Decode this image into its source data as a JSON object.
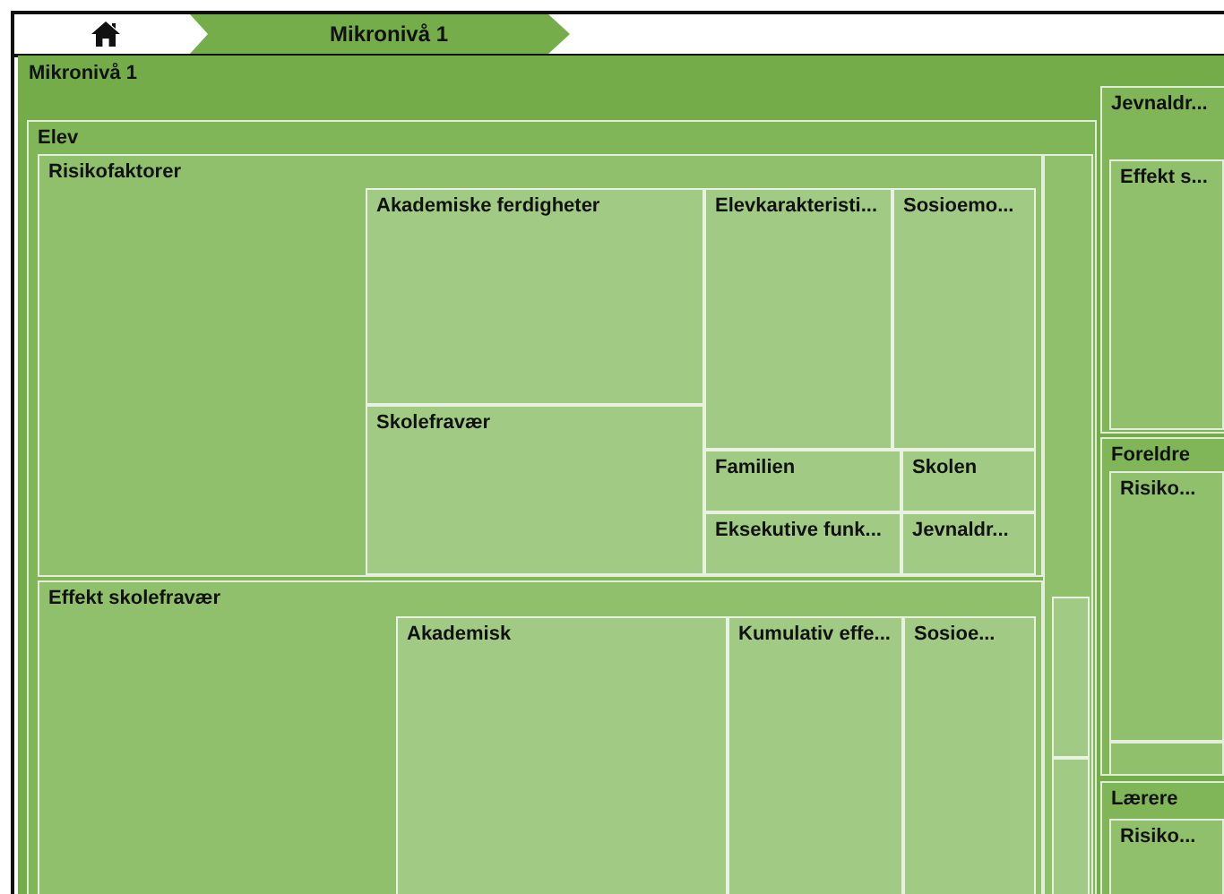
{
  "breadcrumb": [
    {
      "kind": "home"
    },
    {
      "kind": "crumb",
      "label": "Mikronivå 1"
    }
  ],
  "treemap": {
    "kind": "tile",
    "label": "Mikronivå 1",
    "children": [
      {
        "kind": "tile",
        "label": "Elev",
        "children": [
          {
            "kind": "tile",
            "label": "Risikofaktorer",
            "children": [
              {
                "kind": "tile",
                "label": "Akademiske ferdigheter"
              },
              {
                "kind": "tile",
                "label": "Skolefravær"
              },
              {
                "kind": "tile",
                "label": "Elevkarakteristi..."
              },
              {
                "kind": "tile",
                "label": "Sosioemo..."
              },
              {
                "kind": "tile",
                "label": "Familien"
              },
              {
                "kind": "tile",
                "label": "Skolen"
              },
              {
                "kind": "tile",
                "label": "Eksekutive funk..."
              },
              {
                "kind": "tile",
                "label": "Jevnaldr..."
              }
            ]
          },
          {
            "kind": "tile",
            "label": "Effekt skolefravær",
            "children": [
              {
                "kind": "tile",
                "label": "Akademisk"
              },
              {
                "kind": "tile",
                "label": "Kumulativ effe..."
              },
              {
                "kind": "tile",
                "label": "Sosioe..."
              }
            ]
          },
          {
            "kind": "tile",
            "children": [
              {
                "kind": "tile"
              },
              {
                "kind": "tile"
              }
            ]
          }
        ]
      },
      {
        "kind": "tile",
        "label": "Jevnaldr...",
        "children": [
          {
            "kind": "tile",
            "label": "Effekt s..."
          }
        ]
      },
      {
        "kind": "tile",
        "label": "Foreldre",
        "children": [
          {
            "kind": "tile",
            "label": "Risiko..."
          },
          {
            "kind": "tile"
          }
        ]
      },
      {
        "kind": "tile",
        "label": "Lærere",
        "children": [
          {
            "kind": "tile",
            "label": "Risiko..."
          }
        ]
      }
    ]
  }
}
